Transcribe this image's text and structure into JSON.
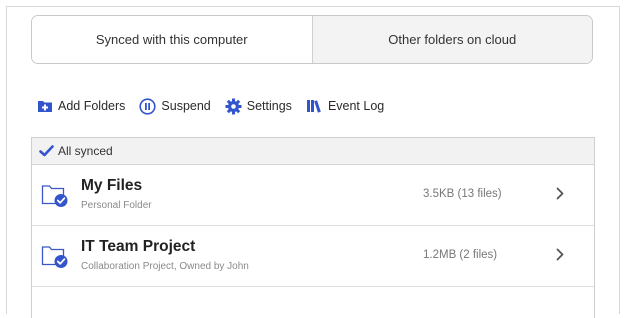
{
  "tabs": [
    {
      "label": "Synced with this computer",
      "active": true
    },
    {
      "label": "Other folders on cloud",
      "active": false
    }
  ],
  "toolbar": {
    "add_folders": "Add Folders",
    "suspend": "Suspend",
    "settings": "Settings",
    "event_log": "Event Log"
  },
  "status": {
    "label": "All synced"
  },
  "folders": [
    {
      "name": "My Files",
      "description": "Personal Folder",
      "size": "3.5KB (13 files)"
    },
    {
      "name": "IT Team Project",
      "description": "Collaboration Project, Owned by John",
      "size": "1.2MB (2 files)"
    }
  ],
  "colors": {
    "accent": "#3355cc",
    "folder_outline": "#3b57c4",
    "header_bg": "#f2f2f2"
  }
}
